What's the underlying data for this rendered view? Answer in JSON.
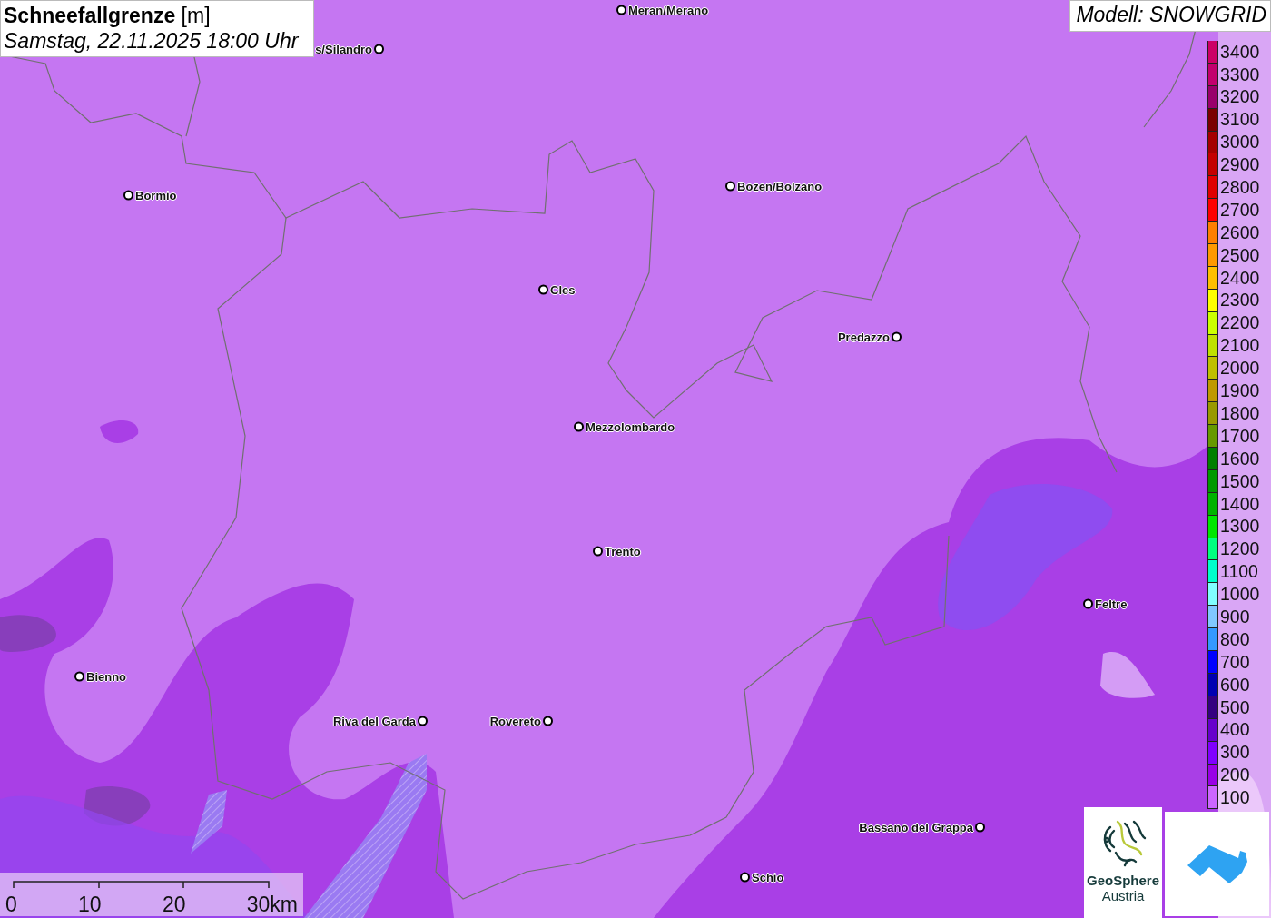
{
  "title": {
    "heading": "**Schneefallgrenze** [m]",
    "date": "Samstag, 22.11.2025 18:00 Uhr"
  },
  "model": "Modell: SNOWGRID",
  "cities": [
    {
      "name": "s/Silandro"
    },
    {
      "name": "Meran/Merano"
    },
    {
      "name": "Bormio"
    },
    {
      "name": "Bozen/Bolzano"
    },
    {
      "name": "Cles"
    },
    {
      "name": "Predazzo"
    },
    {
      "name": "Mezzolombardo"
    },
    {
      "name": "Trento"
    },
    {
      "name": "Feltre"
    },
    {
      "name": "Bienno"
    },
    {
      "name": "Riva del Garda"
    },
    {
      "name": "Rovereto"
    },
    {
      "name": "Bassano del Grappa"
    },
    {
      "name": "Schio"
    }
  ],
  "legend": [
    {
      "label": "3400",
      "color": "#cc0066"
    },
    {
      "label": "3300",
      "color": "#c2006e"
    },
    {
      "label": "3200",
      "color": "#99006b"
    },
    {
      "label": "3100",
      "color": "#7a0000"
    },
    {
      "label": "3000",
      "color": "#a50000"
    },
    {
      "label": "2900",
      "color": "#c40000"
    },
    {
      "label": "2800",
      "color": "#e00000"
    },
    {
      "label": "2700",
      "color": "#ff0000"
    },
    {
      "label": "2600",
      "color": "#ff7f00"
    },
    {
      "label": "2500",
      "color": "#ff9900"
    },
    {
      "label": "2400",
      "color": "#ffbf00"
    },
    {
      "label": "2300",
      "color": "#ffff00"
    },
    {
      "label": "2200",
      "color": "#ccff00"
    },
    {
      "label": "2100",
      "color": "#bfe000"
    },
    {
      "label": "2000",
      "color": "#bfbf00"
    },
    {
      "label": "1900",
      "color": "#bf9900"
    },
    {
      "label": "1800",
      "color": "#999900"
    },
    {
      "label": "1700",
      "color": "#669900"
    },
    {
      "label": "1600",
      "color": "#007f00"
    },
    {
      "label": "1500",
      "color": "#009900"
    },
    {
      "label": "1400",
      "color": "#00b200"
    },
    {
      "label": "1300",
      "color": "#00e600"
    },
    {
      "label": "1200",
      "color": "#00ff80"
    },
    {
      "label": "1100",
      "color": "#00ffcc"
    },
    {
      "label": "1000",
      "color": "#80ffff"
    },
    {
      "label": "900",
      "color": "#80c8ff"
    },
    {
      "label": "800",
      "color": "#3399ff"
    },
    {
      "label": "700",
      "color": "#0000ff"
    },
    {
      "label": "600",
      "color": "#0000b2"
    },
    {
      "label": "500",
      "color": "#330080"
    },
    {
      "label": "400",
      "color": "#6600cc"
    },
    {
      "label": "300",
      "color": "#8000ff"
    },
    {
      "label": "200",
      "color": "#9900e6"
    },
    {
      "label": "100",
      "color": "#cc66ff"
    }
  ],
  "scale": [
    "0",
    "10",
    "20",
    "30km"
  ],
  "logo": {
    "line1": "GeoSphere",
    "line2": "Austria"
  }
}
